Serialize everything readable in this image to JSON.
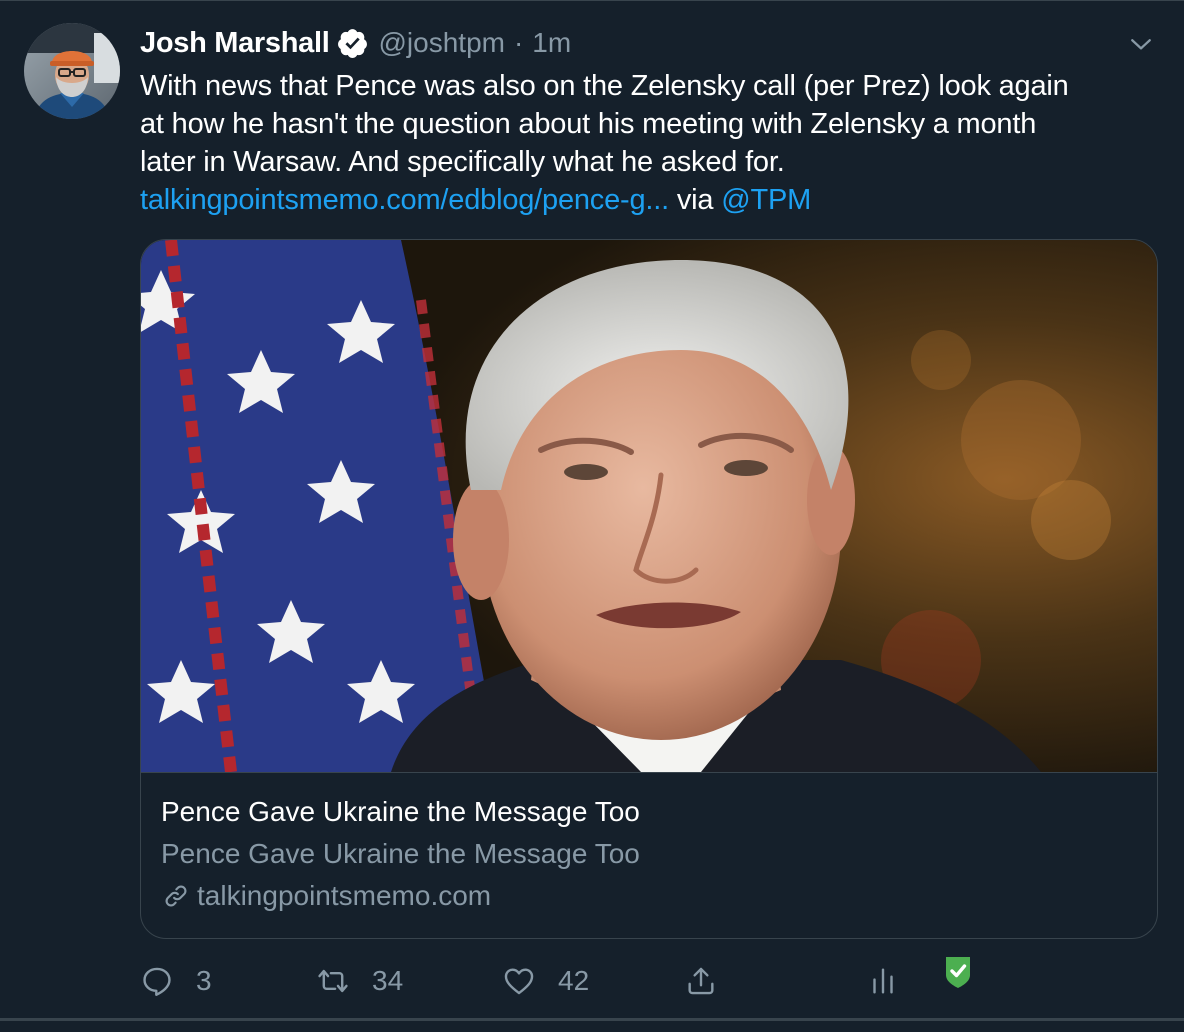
{
  "tweet": {
    "author": {
      "name": "Josh Marshall",
      "handle": "@joshtpm",
      "separator": "·",
      "time": "1m",
      "verified": true
    },
    "text_lines": [
      {
        "text": "With news that Pence was also on the Zelensky call (per Prez) look again"
      },
      {
        "text": "at how he hasn't the question about his meeting with Zelensky a month"
      },
      {
        "text": "later in Warsaw. And specifically what he asked for."
      }
    ],
    "link": {
      "url": "talkingpointsmemo.com/edblog/pence-g...",
      "via": "via",
      "mention": "@TPM"
    },
    "card": {
      "title": "Pence Gave Ukraine the Message Too",
      "description": "Pence Gave Ukraine the Message Too",
      "domain": "talkingpointsmemo.com"
    },
    "actions": {
      "replies": "3",
      "retweets": "34",
      "likes": "42"
    }
  },
  "icons": {
    "verified": "verified-badge-icon",
    "menu": "chevron-down-icon",
    "reply": "reply-icon",
    "retweet": "retweet-icon",
    "like": "heart-icon",
    "share": "share-icon",
    "analytics": "analytics-icon",
    "extension": "shield-check-icon",
    "card_link": "link-icon"
  },
  "colors": {
    "background": "#15202b",
    "border": "#38444d",
    "text": "#ffffff",
    "muted": "#8899a6",
    "link": "#1da1f2",
    "shield": "#4caf50"
  }
}
